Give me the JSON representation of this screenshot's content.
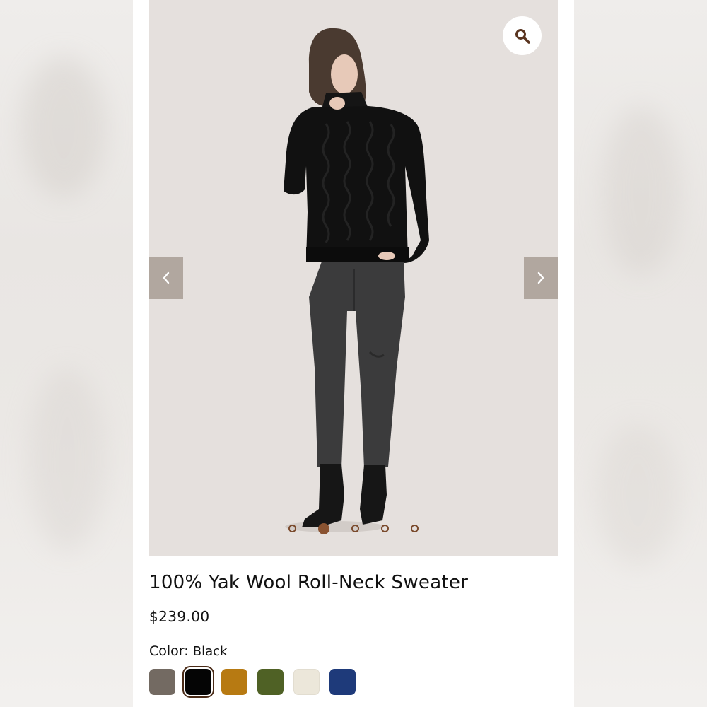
{
  "product": {
    "title": "100% Yak Wool Roll-Neck Sweater",
    "price": "$239.00",
    "color_label": "Color:",
    "color_value": "Black"
  },
  "gallery": {
    "image_count": 5,
    "active_index": 1
  },
  "swatches": [
    {
      "name": "taupe",
      "color": "#736a62",
      "selected": false
    },
    {
      "name": "black",
      "color": "#050505",
      "selected": true
    },
    {
      "name": "camel",
      "color": "#b77a12",
      "selected": false
    },
    {
      "name": "olive",
      "color": "#4f6125",
      "selected": false
    },
    {
      "name": "cream",
      "color": "#ece7da",
      "selected": false
    },
    {
      "name": "navy",
      "color": "#1e3a7a",
      "selected": false
    }
  ],
  "colors": {
    "gallery_bg": "#e5e0dd",
    "nav_bg": "#b1a79f",
    "dot_accent": "#8a5331"
  },
  "icons": {
    "zoom": "magnifier-icon",
    "prev": "chevron-left-icon",
    "next": "chevron-right-icon"
  }
}
